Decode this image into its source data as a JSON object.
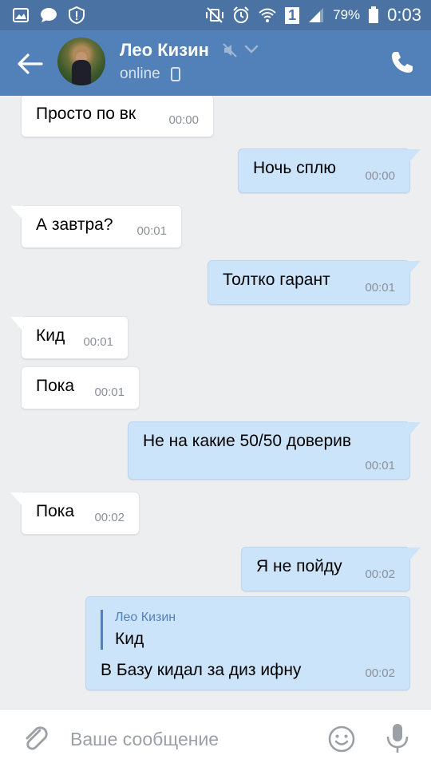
{
  "status_bar": {
    "battery": "79%",
    "time": "0:03",
    "sim": "1"
  },
  "header": {
    "contact_name": "Лео Кизин",
    "status": "online"
  },
  "messages": [
    {
      "dir": "in",
      "text": "Просто по вк",
      "time": "00:00"
    },
    {
      "dir": "out",
      "text": "Ночь сплю",
      "time": "00:00"
    },
    {
      "dir": "in",
      "text": "А завтра?",
      "time": "00:01"
    },
    {
      "dir": "out",
      "text": "Толтко гарант",
      "time": "00:01"
    },
    {
      "dir": "in",
      "text": "Кид",
      "time": "00:01"
    },
    {
      "dir": "in",
      "text": "Пока",
      "time": "00:01"
    },
    {
      "dir": "out",
      "text": "Не на какие 50/50 доверив",
      "time": "00:01"
    },
    {
      "dir": "in",
      "text": "Пока",
      "time": "00:02"
    },
    {
      "dir": "out",
      "text": "Я не пойду",
      "time": "00:02"
    },
    {
      "dir": "out",
      "reply_author": "Лео Кизин",
      "reply_text": "Кид",
      "text": "В Базу кидал за диз ифну",
      "time": "00:02"
    }
  ],
  "composer": {
    "placeholder": "Ваше сообщение"
  },
  "colors": {
    "header": "#5181b8",
    "status_bar": "#4a72a3",
    "incoming_bubble": "#ffffff",
    "outgoing_bubble": "#cce4fa",
    "background": "#edeef0"
  }
}
